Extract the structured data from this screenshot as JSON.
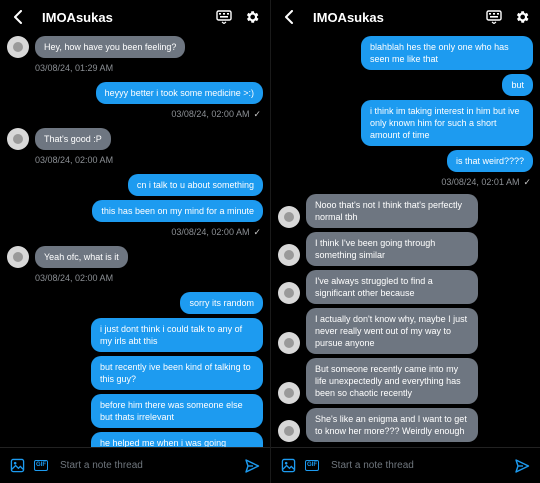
{
  "conversation_title": "IMOAsukas",
  "composer_placeholder": "Start a note thread",
  "gif_label": "GIF",
  "colors": {
    "outgoing": "#1d9bf0",
    "incoming": "#6e7681",
    "background": "#000000"
  },
  "left": [
    {
      "type": "in",
      "text": "Hey, how have you been feeling?",
      "avatar": true
    },
    {
      "type": "meta",
      "side": "in",
      "text": "03/08/24, 01:29 AM"
    },
    {
      "type": "out",
      "text": "heyyy better i took some medicine >:)"
    },
    {
      "type": "meta",
      "side": "out",
      "text": "03/08/24, 02:00 AM",
      "check": true
    },
    {
      "type": "in",
      "text": "That's good :P",
      "avatar": true
    },
    {
      "type": "meta",
      "side": "in",
      "text": "03/08/24, 02:00 AM"
    },
    {
      "type": "out",
      "text": "cn i talk to u about something"
    },
    {
      "type": "out",
      "text": "this has been on my mind for a minute"
    },
    {
      "type": "meta",
      "side": "out",
      "text": "03/08/24, 02:00 AM",
      "check": true
    },
    {
      "type": "in",
      "text": "Yeah ofc, what is it",
      "avatar": true
    },
    {
      "type": "meta",
      "side": "in",
      "text": "03/08/24, 02:00 AM"
    },
    {
      "type": "out",
      "text": "sorry its random"
    },
    {
      "type": "out",
      "text": "i just dont think i could talk to any of my irls abt this"
    },
    {
      "type": "out",
      "text": "but recently ive been kind of talking to this guy?"
    },
    {
      "type": "out",
      "text": "before him there was someone else but thats irrelevant"
    },
    {
      "type": "out",
      "text": "he helped me when i was going through something really bad"
    }
  ],
  "right": [
    {
      "type": "out",
      "text": "blahblah hes the only one who has seen me like that"
    },
    {
      "type": "out",
      "text": "but"
    },
    {
      "type": "out",
      "text": "i think im taking interest in him but ive only known him for such a short amount of time"
    },
    {
      "type": "out",
      "text": "is that weird????"
    },
    {
      "type": "meta",
      "side": "out",
      "text": "03/08/24, 02:01 AM",
      "check": true
    },
    {
      "type": "in",
      "text": "Nooo that's not I think that's perfectly normal tbh",
      "avatar": true
    },
    {
      "type": "in",
      "text": "I think I've been going through something similar",
      "avatar": true
    },
    {
      "type": "in",
      "text": "I've always struggled to find a significant other because",
      "avatar": true
    },
    {
      "type": "in",
      "text": "I actually don't know why, maybe I just never really went out of my way to pursue anyone",
      "avatar": true
    },
    {
      "type": "in",
      "text": "But someone recently came into my life unexpectedly and everything has been so chaotic recently",
      "avatar": true
    },
    {
      "type": "in",
      "text": "She's like an enigma and I want to get to know her more??? Weirdly enough",
      "avatar": true
    },
    {
      "type": "in",
      "text": "",
      "avatar": false
    }
  ]
}
